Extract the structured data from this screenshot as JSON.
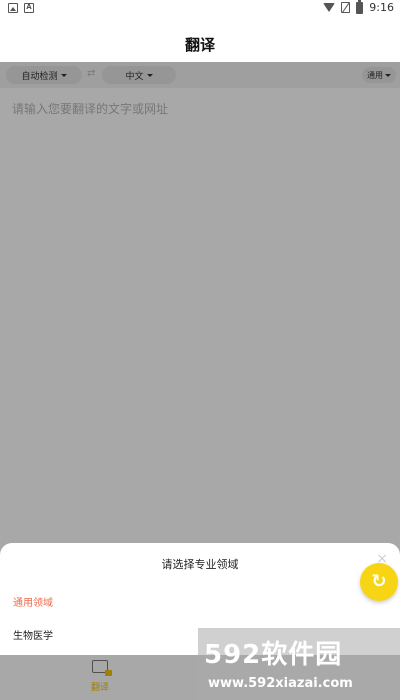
{
  "status_bar": {
    "time": "9:16",
    "icons": [
      "image-icon",
      "a-icon",
      "wifi-icon",
      "no-sim-icon",
      "battery-icon"
    ]
  },
  "header": {
    "title": "翻译"
  },
  "lang_bar": {
    "source_lang": "自动检测",
    "target_lang": "中文",
    "swap_symbol": "⇄",
    "domain": "通用"
  },
  "input": {
    "placeholder": "请输入您要翻译的文字或网址",
    "value": ""
  },
  "sheet": {
    "title": "请选择专业领域",
    "close_symbol": "×",
    "options": [
      {
        "label": "通用领域",
        "selected": true
      },
      {
        "label": "生物医学",
        "selected": false
      }
    ]
  },
  "fab": {
    "icon": "refresh-icon",
    "symbol": "↻"
  },
  "bottom_nav": {
    "items": [
      {
        "label": "翻译",
        "icon": "translate-icon",
        "active": true
      }
    ]
  },
  "watermark": {
    "logo": "592软件园",
    "url": "www.592xiazai.com"
  },
  "colors": {
    "accent": "#f7d514",
    "selected_option": "#f06a4a",
    "nav_active": "#f2c200"
  }
}
